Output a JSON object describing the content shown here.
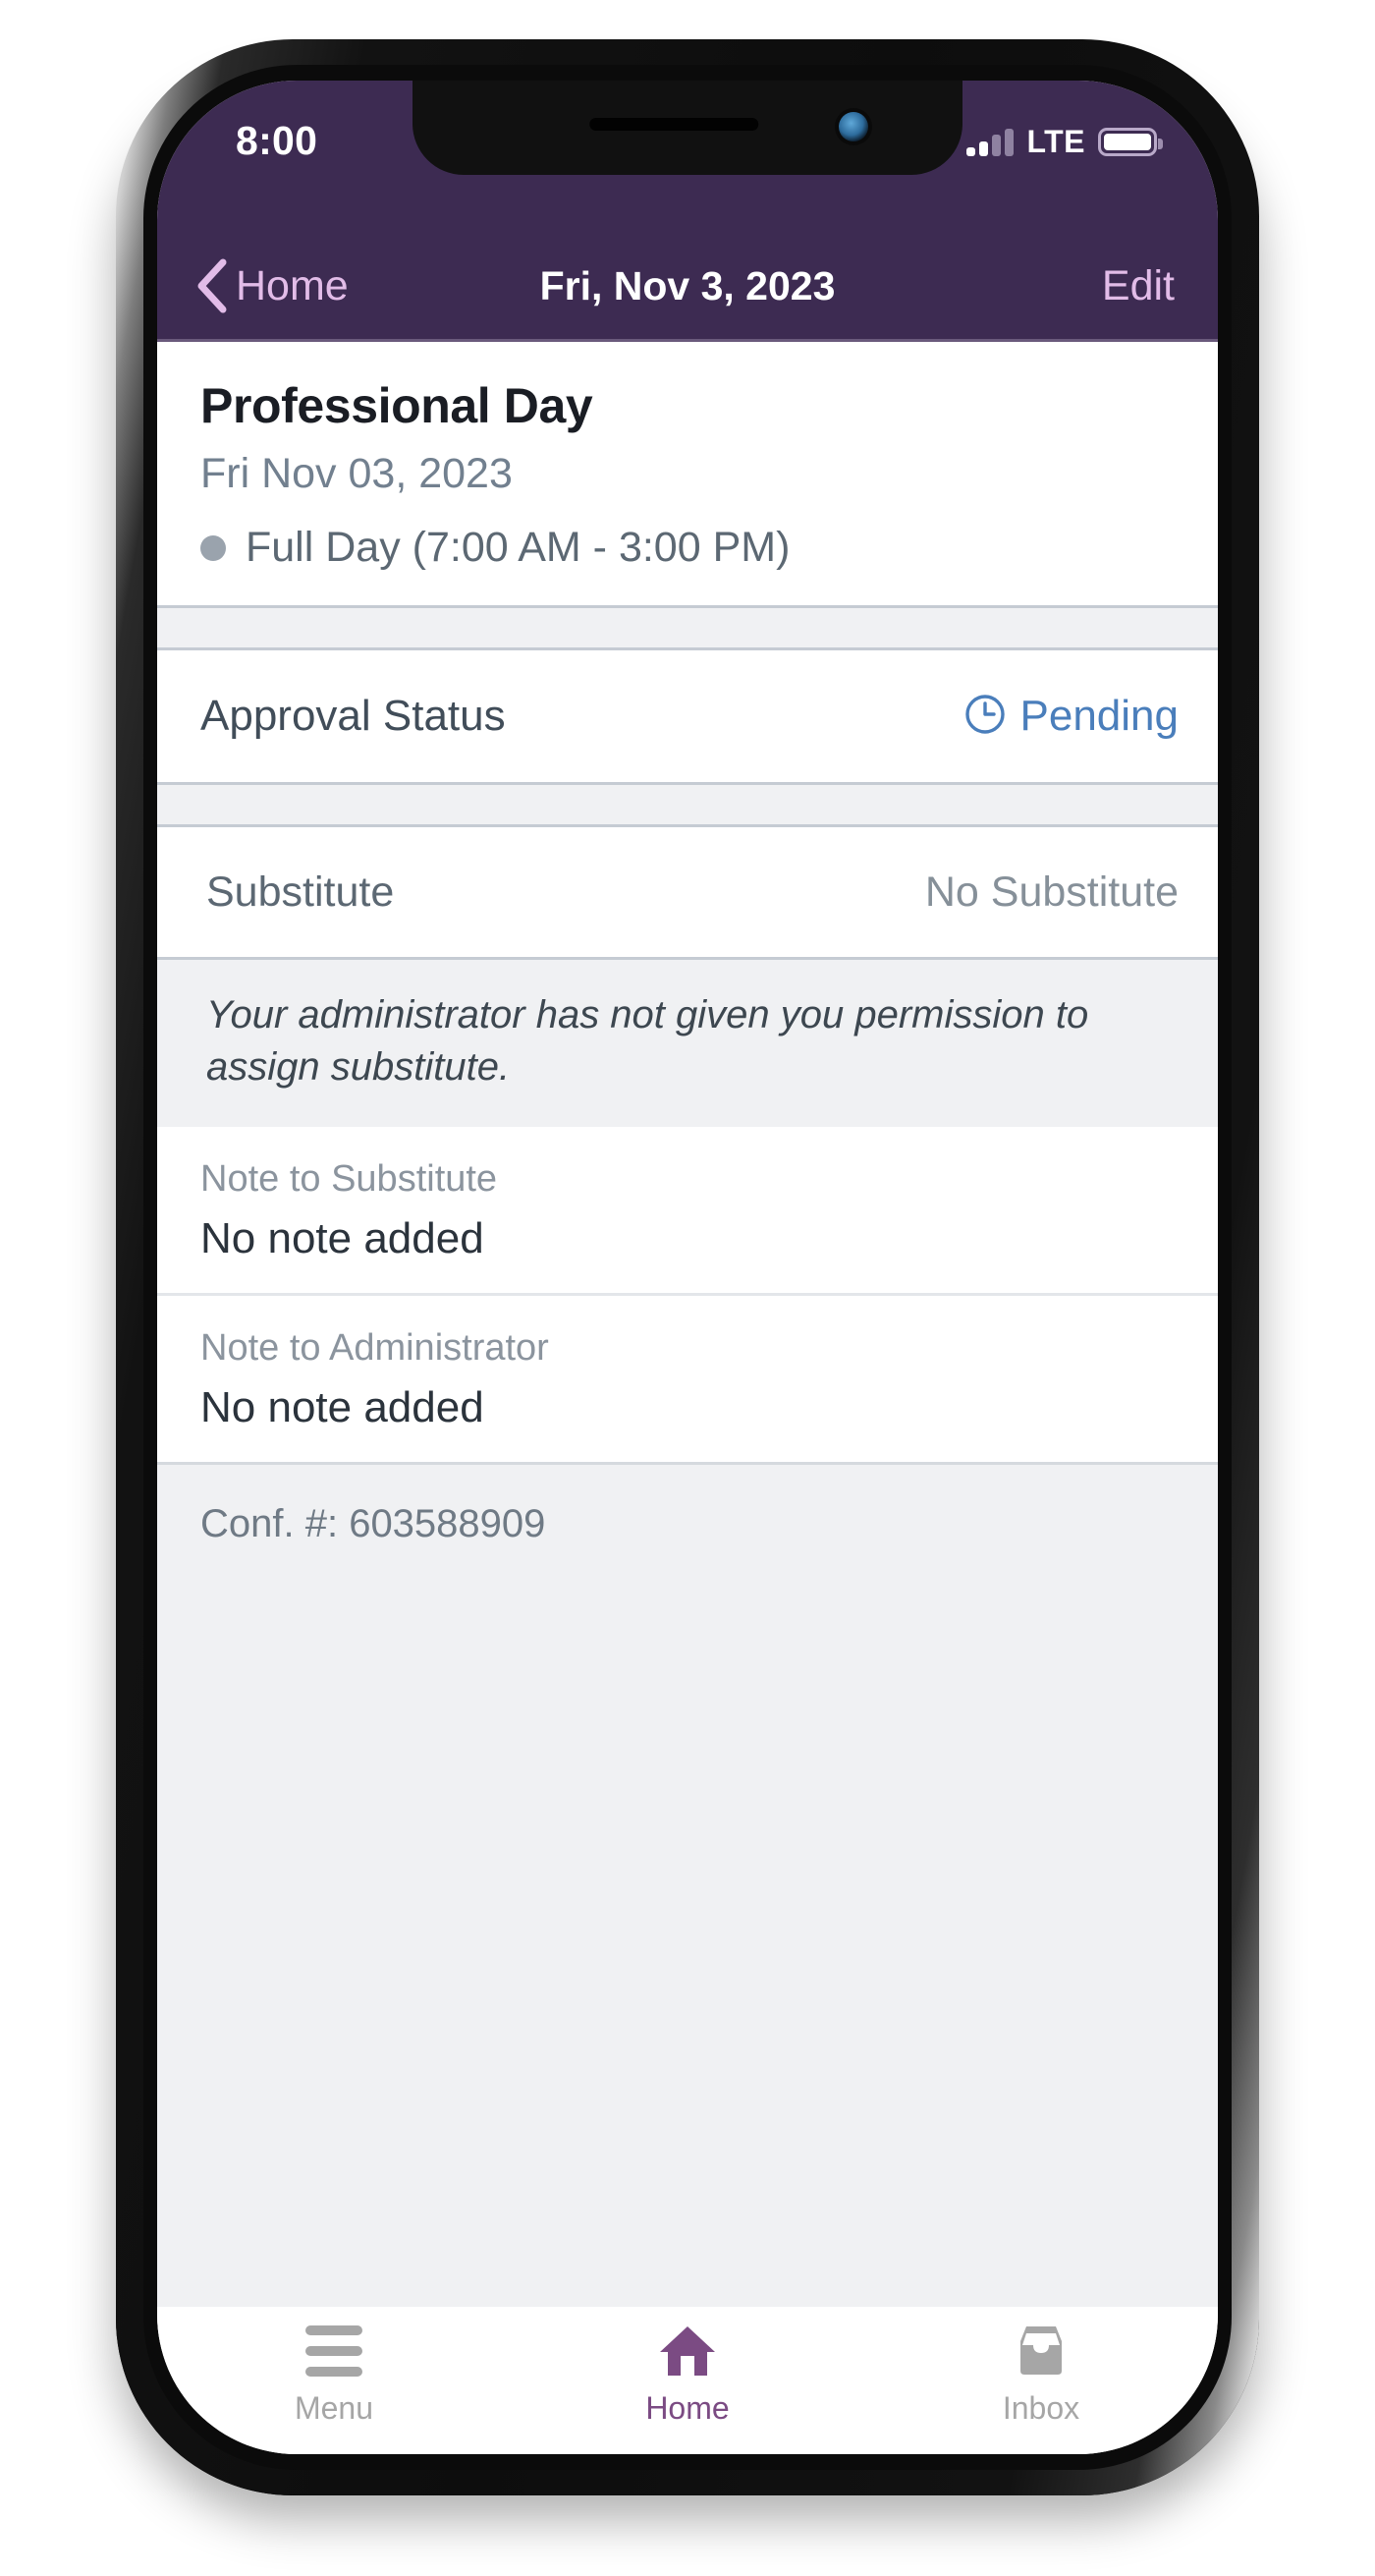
{
  "status_bar": {
    "time": "8:00",
    "network_label": "LTE",
    "signal_icon": "signal-bars-icon",
    "battery_icon": "battery-full-icon"
  },
  "nav_bar": {
    "back_icon": "chevron-left-icon",
    "back_label": "Home",
    "title": "Fri, Nov 3, 2023",
    "edit_label": "Edit"
  },
  "event": {
    "title": "Professional Day",
    "date": "Fri Nov 03, 2023",
    "duration": "Full Day (7:00 AM - 3:00 PM)",
    "duration_dot_icon": "status-dot-icon"
  },
  "approval": {
    "label": "Approval Status",
    "status_icon": "clock-icon",
    "status": "Pending"
  },
  "substitute": {
    "label": "Substitute",
    "value": "No Substitute",
    "permission_note": "Your administrator has not given you permission to assign substitute."
  },
  "notes": [
    {
      "label": "Note to Substitute",
      "value": "No note added"
    },
    {
      "label": "Note to Administrator",
      "value": "No note added"
    }
  ],
  "confirmation": {
    "text": "Conf. #: 603588909"
  },
  "tab_bar": {
    "items": [
      {
        "label": "Menu",
        "icon": "hamburger-menu-icon",
        "active": false
      },
      {
        "label": "Home",
        "icon": "home-icon",
        "active": true
      },
      {
        "label": "Inbox",
        "icon": "inbox-tray-icon",
        "active": false
      }
    ]
  },
  "colors": {
    "nav_purple": "#3d2b52",
    "accent_purple": "#7b4b83",
    "nav_link": "#e2bce8",
    "status_blue": "#4a7ebb",
    "section_gray": "#f0f1f3",
    "divider": "#c5cbd3"
  }
}
